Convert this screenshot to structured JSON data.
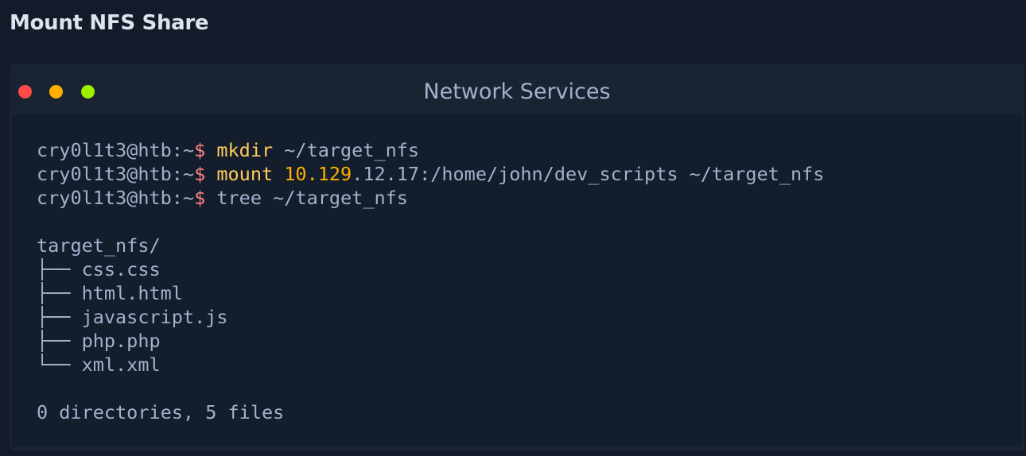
{
  "page": {
    "title": "Mount NFS Share"
  },
  "window": {
    "title": "Network Services"
  },
  "terminal": {
    "prompt": "cry0l1t3@htb:~",
    "prompt_symbol": "$",
    "commands": [
      {
        "cmd": "mkdir",
        "args": " ~/target_nfs"
      },
      {
        "cmd": "mount",
        "ip_part": " 10.129",
        "args": ".12.17:/home/john/dev_scripts ~/target_nfs"
      },
      {
        "cmd": "",
        "args": " tree ~/target_nfs"
      }
    ],
    "output": {
      "root": "target_nfs/",
      "entries": [
        "├── css.css",
        "├── html.html",
        "├── javascript.js",
        "├── php.php",
        "└── xml.xml"
      ],
      "summary": "0 directories, 5 files"
    }
  },
  "colors": {
    "background": "#131b2a",
    "terminal_body": "#141d2b",
    "prompt_symbol": "#ff8484",
    "command": "#ffcc5c",
    "ip": "#ffaf00",
    "text": "#a4b1cd",
    "dot_red": "#ff4a4a",
    "dot_yellow": "#ffaf00",
    "dot_green": "#9fef00"
  }
}
